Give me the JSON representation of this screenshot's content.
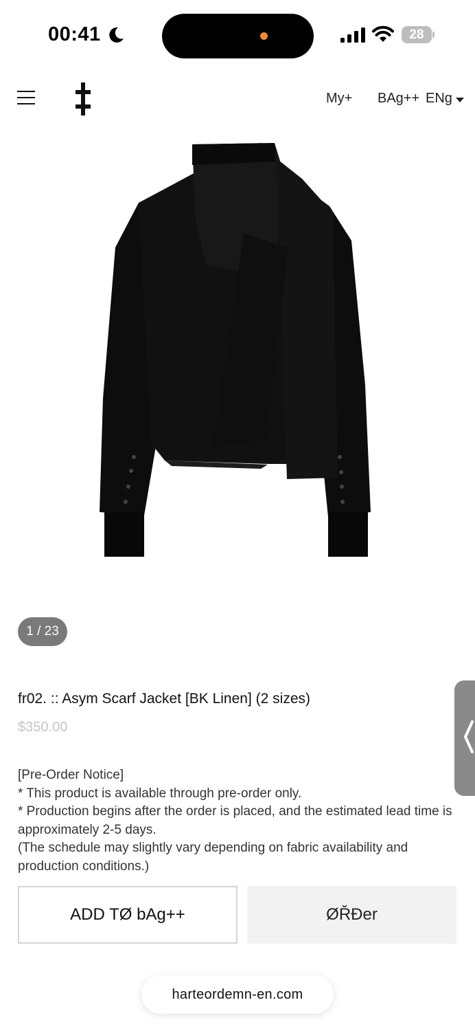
{
  "status_bar": {
    "time": "00:41",
    "battery": "28",
    "island_dot_color": "#f08a2c"
  },
  "header": {
    "menu_icon": "hamburger-icon",
    "logo_icon": "double-cross-logo",
    "nav": {
      "my": "My+",
      "bag": "BAg++",
      "lang": "ENg"
    }
  },
  "gallery": {
    "counter": "1 / 23",
    "current": 1,
    "total": 23
  },
  "product": {
    "title": "fr02. :: Asym Scarf Jacket [BK Linen] (2 sizes)",
    "price": "$350.00",
    "description": [
      "[Pre-Order Notice]",
      "* This product is available through pre-order only.",
      "* Production begins after the order is placed, and the estimated lead time is approximately 2-5 days.",
      "(The schedule may slightly vary depending on fabric availability and production conditions.)"
    ]
  },
  "actions": {
    "add_to_bag": "ADD TØ bAg++",
    "order": "ØŘĐer"
  },
  "browser": {
    "url": "harteordemn-en.com"
  },
  "colors": {
    "price": "#c4c4c4",
    "counter_bg": "#7a7a7a",
    "side_tab": "#8a8a8a"
  }
}
